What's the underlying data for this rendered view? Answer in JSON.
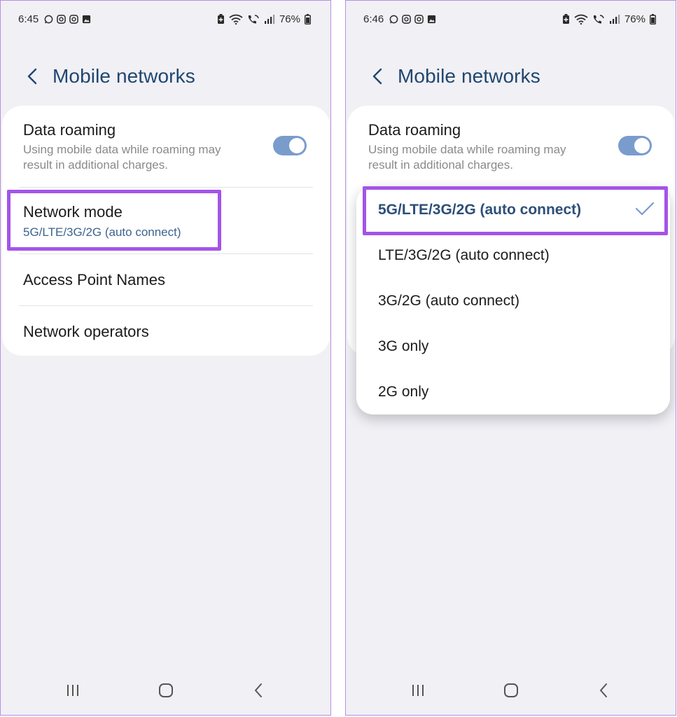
{
  "left_screen": {
    "status_bar": {
      "time": "6:45",
      "battery": "76%",
      "left_icons": [
        "whatsapp-icon",
        "instagram-icon",
        "instagram-icon",
        "gallery-icon"
      ],
      "right_icons": [
        "battery-saver-icon",
        "wifi-icon",
        "wifi-call-icon",
        "signal-icon"
      ]
    },
    "header": {
      "title": "Mobile networks"
    },
    "settings": {
      "data_roaming": {
        "title": "Data roaming",
        "subtitle_line1": "Using mobile data while roaming may",
        "subtitle_line2": "result in additional charges.",
        "enabled": true
      },
      "network_mode": {
        "title": "Network mode",
        "value": "5G/LTE/3G/2G (auto connect)"
      },
      "apn": {
        "title": "Access Point Names"
      },
      "operators": {
        "title": "Network operators"
      }
    }
  },
  "right_screen": {
    "status_bar": {
      "time": "6:46",
      "battery": "76%",
      "left_icons": [
        "whatsapp-icon",
        "instagram-icon",
        "instagram-icon",
        "gallery-icon"
      ],
      "right_icons": [
        "battery-saver-icon",
        "wifi-icon",
        "wifi-call-icon",
        "signal-icon"
      ]
    },
    "header": {
      "title": "Mobile networks"
    },
    "settings": {
      "data_roaming": {
        "title": "Data roaming",
        "subtitle_line1": "Using mobile data while roaming may",
        "subtitle_line2": "result in additional charges.",
        "enabled": true
      }
    },
    "network_mode_options": [
      {
        "label": "5G/LTE/3G/2G (auto connect)",
        "selected": true
      },
      {
        "label": "LTE/3G/2G (auto connect)",
        "selected": false
      },
      {
        "label": "3G/2G (auto connect)",
        "selected": false
      },
      {
        "label": "3G only",
        "selected": false
      },
      {
        "label": "2G only",
        "selected": false
      }
    ]
  },
  "colors": {
    "background": "#f0f0f5",
    "card": "#ffffff",
    "title": "#21466f",
    "value_blue": "#3c6390",
    "toggle_on": "#7a9ccd",
    "highlight": "#a454e8",
    "check": "#7a9ccd"
  },
  "navbar_icons": [
    "recent-apps-icon",
    "home-icon",
    "back-icon"
  ]
}
